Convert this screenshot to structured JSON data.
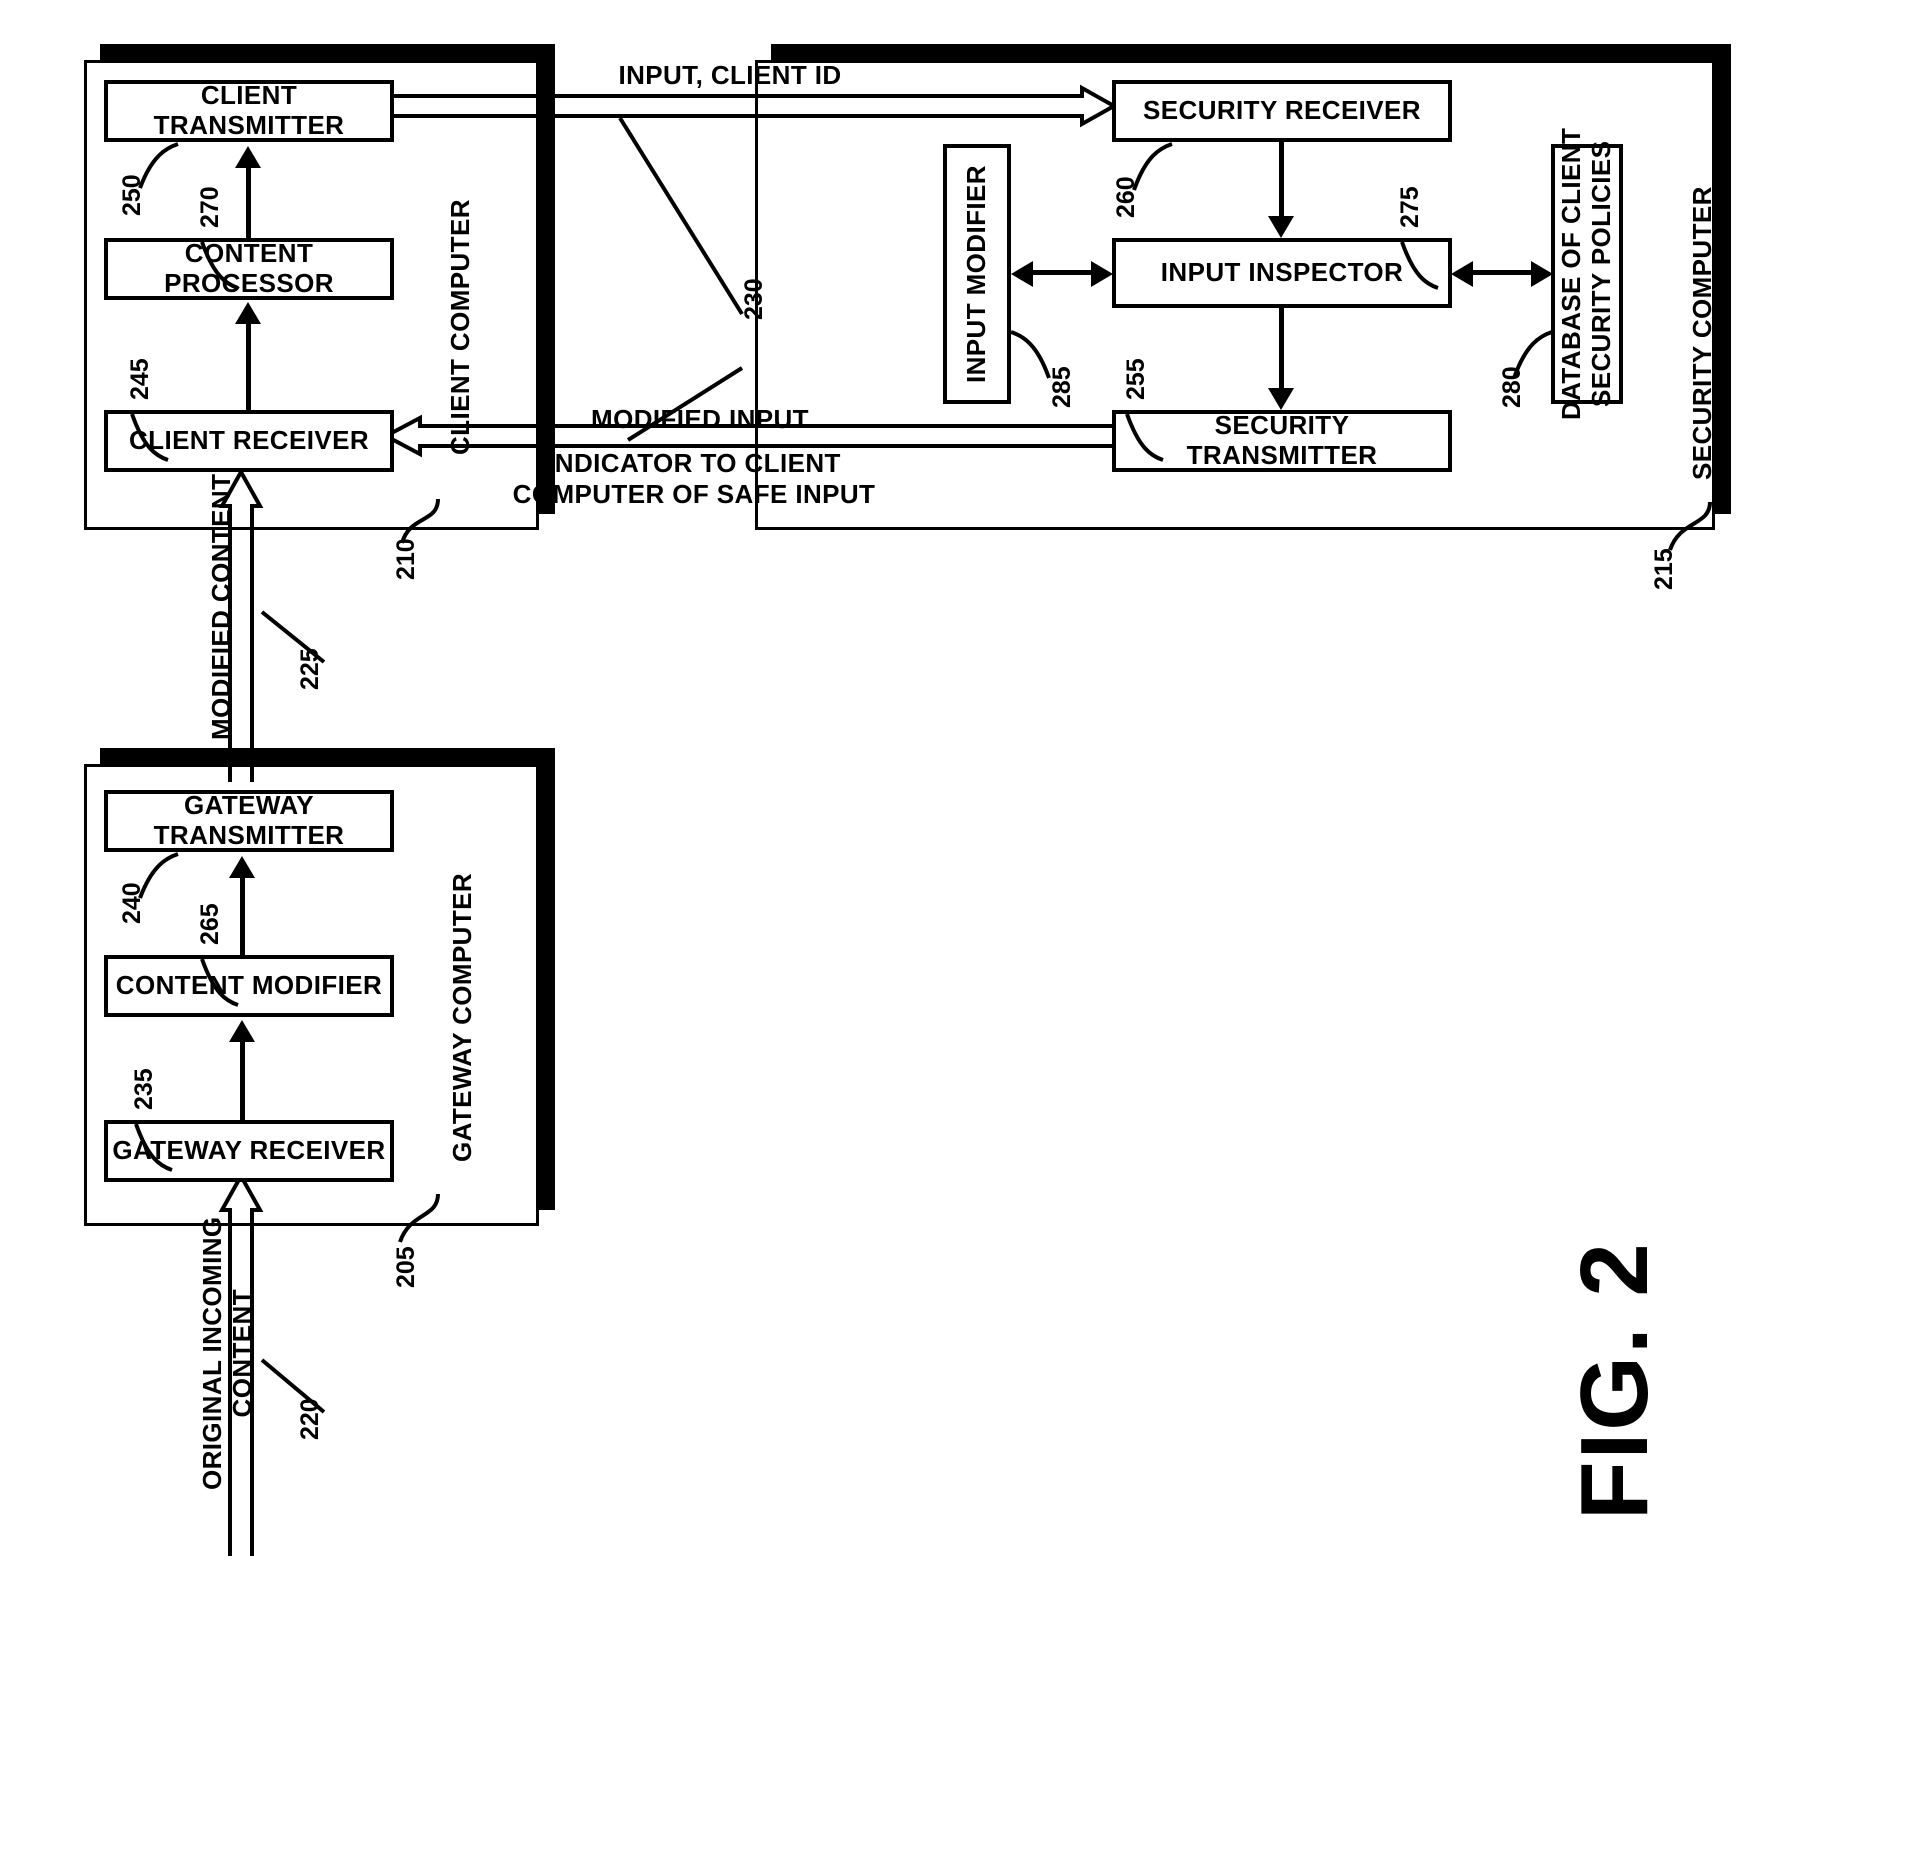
{
  "figure": {
    "label": "FIG. 2",
    "title": "System block diagram of gateway, client and security computers"
  },
  "containers": [
    {
      "id": "client-computer",
      "label": "CLIENT COMPUTER",
      "ref": "210"
    },
    {
      "id": "security-computer",
      "label": "SECURITY COMPUTER",
      "ref": "215"
    },
    {
      "id": "gateway-computer",
      "label": "GATEWAY COMPUTER",
      "ref": "205"
    }
  ],
  "boxes": {
    "client_transmitter": {
      "label": "CLIENT TRANSMITTER",
      "ref": "250"
    },
    "content_processor": {
      "label": "CONTENT PROCESSOR",
      "ref": "270"
    },
    "client_receiver": {
      "label": "CLIENT RECEIVER",
      "ref": "245"
    },
    "security_receiver": {
      "label": "SECURITY RECEIVER",
      "ref": "260"
    },
    "input_inspector": {
      "label": "INPUT INSPECTOR",
      "ref": "275"
    },
    "input_modifier": {
      "label": "INPUT MODIFIER",
      "ref": "285"
    },
    "security_transmitter": {
      "label": "SECURITY TRANSMITTER",
      "ref": "255"
    },
    "policy_database": {
      "label": "DATABASE OF CLIENT\nSECURITY POLICIES",
      "ref": "280"
    },
    "gateway_transmitter": {
      "label": "GATEWAY TRANSMITTER",
      "ref": "240"
    },
    "content_modifier": {
      "label": "CONTENT MODIFIER",
      "ref": "265"
    },
    "gateway_receiver": {
      "label": "GATEWAY RECEIVER",
      "ref": "235"
    }
  },
  "flows": {
    "input_client_id": {
      "label": "INPUT, CLIENT ID",
      "ref": "230"
    },
    "modified_input": {
      "label": "MODIFIED INPUT",
      "ref": "230"
    },
    "safe_input_indicator": {
      "label": "INDICATOR TO CLIENT\nCOMPUTER OF SAFE INPUT",
      "ref": "230"
    },
    "modified_content": {
      "label": "MODIFIED CONTENT",
      "ref": "225"
    },
    "original_content": {
      "label": "ORIGINAL INCOMING\nCONTENT",
      "ref": "220"
    }
  },
  "colors": {
    "ink": "#000000",
    "paper": "#ffffff"
  }
}
